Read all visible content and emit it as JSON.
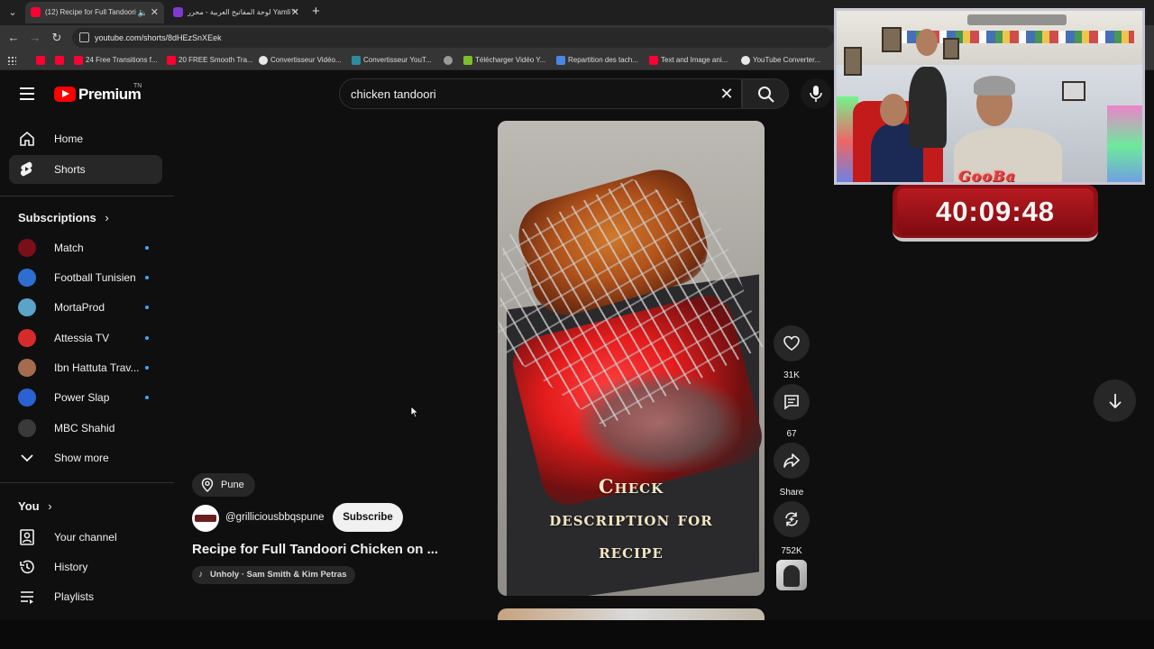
{
  "browser": {
    "tabs": [
      {
        "title": "(12) Recipe for Full Tandoori",
        "active": true,
        "fav_color": "#ff0033"
      },
      {
        "title": "لوحة المفاتيح العربية - محرر Yamli™",
        "active": false,
        "fav_color": "#7e3bd0"
      }
    ],
    "url": "youtube.com/shorts/8dHEzSnXEek",
    "bookmarks": [
      {
        "label": "",
        "fav_color": "#ff0033"
      },
      {
        "label": "",
        "fav_color": "#ff0033"
      },
      {
        "label": "24 Free Transitions f...",
        "fav_color": "#ff0033"
      },
      {
        "label": "20 FREE Smooth Tra...",
        "fav_color": "#ff0033"
      },
      {
        "label": "Convertisseur Vidéo...",
        "fav_color": "#e8e8e8"
      },
      {
        "label": "Convertisseur YouT...",
        "fav_color": "#2f8aa0"
      },
      {
        "label": "",
        "fav_color": "#9a9a9a"
      },
      {
        "label": "Télécharger Vidéo Y...",
        "fav_color": "#7bbf2a"
      },
      {
        "label": "Repartition des tach...",
        "fav_color": "#4a86e8"
      },
      {
        "label": "Text and Image ani...",
        "fav_color": "#ff0033"
      },
      {
        "label": "YouTube Converter...",
        "fav_color": "#e8e8e8"
      }
    ]
  },
  "masthead": {
    "logo_word": "Premium",
    "logo_superscript": "TN",
    "search_value": "chicken tandoori",
    "search_placeholder": "Search"
  },
  "sidebar": {
    "main": [
      {
        "label": "Home",
        "icon": "home-icon"
      },
      {
        "label": "Shorts",
        "icon": "shorts-icon",
        "active": true
      }
    ],
    "subscriptions_heading": "Subscriptions",
    "subscriptions": [
      {
        "label": "Match",
        "avatar_color": "#7a0f1a"
      },
      {
        "label": "Football Tunisien",
        "avatar_color": "#2c6fd1"
      },
      {
        "label": "MortaProd",
        "avatar_color": "#5aa3c9"
      },
      {
        "label": "Attessia TV",
        "avatar_color": "#d62b2b"
      },
      {
        "label": "Ibn Hattuta Trav...",
        "avatar_color": "#a46b4f"
      },
      {
        "label": "Power Slap",
        "avatar_color": "#2a63d1"
      },
      {
        "label": "MBC Shahid",
        "avatar_color": "#3a3a3a"
      }
    ],
    "show_more": "Show more",
    "you_heading": "You",
    "you_items": [
      {
        "label": "Your channel",
        "icon": "your-channel-icon"
      },
      {
        "label": "History",
        "icon": "history-icon"
      },
      {
        "label": "Playlists",
        "icon": "playlists-icon"
      }
    ]
  },
  "short": {
    "location": "Pune",
    "channel": "@grilliciousbbqspune",
    "subscribe_label": "Subscribe",
    "title": "Recipe for Full Tandoori Chicken on ...",
    "music": "Unholy · Sam Smith & Kim Petras",
    "video_caption_lines": [
      "Check",
      "description for",
      "recipe"
    ],
    "actions": {
      "likes": "31K",
      "comments": "67",
      "share": "Share",
      "remix": "752K"
    }
  },
  "overlay": {
    "streamer_name": "GooBa",
    "timer": "40:09:48"
  }
}
